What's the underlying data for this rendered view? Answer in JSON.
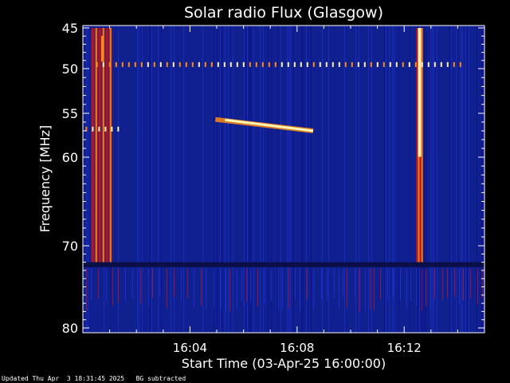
{
  "chart_data": {
    "type": "heatmap",
    "title": "Solar radio Flux (Glasgow)",
    "xlabel": "Start Time (03-Apr-25 16:00:00)",
    "ylabel": "Frequency [MHz]",
    "x_unit": "minutes after 16:00:00",
    "xlim": [
      0,
      15
    ],
    "ylim": [
      45,
      80
    ],
    "x_ticks": [
      {
        "value": 4,
        "label": "16:04"
      },
      {
        "value": 8,
        "label": "16:08"
      },
      {
        "value": 12,
        "label": "16:12"
      }
    ],
    "y_ticks": [
      {
        "value": 45,
        "label": "45"
      },
      {
        "value": 50,
        "label": "50"
      },
      {
        "value": 55,
        "label": "55"
      },
      {
        "value": 60,
        "label": "60"
      },
      {
        "value": 70,
        "label": "70"
      },
      {
        "value": 80,
        "label": "80"
      }
    ],
    "y_scale": "log-like (reversed, low frequency at top)",
    "colormap": [
      "#0a0a8c",
      "#1f35e0",
      "#c01818",
      "#ff8a10",
      "#fff4b0"
    ],
    "background_color": "#10208f",
    "features": [
      {
        "name": "burst",
        "t_start": 0.3,
        "t_end": 1.1,
        "f_low": 45,
        "f_high": 72,
        "intensity": "high"
      },
      {
        "name": "burst",
        "t_start": 12.45,
        "t_end": 12.7,
        "f_low": 45,
        "f_high": 72,
        "intensity": "very high"
      },
      {
        "name": "drifting emission",
        "t_start": 4.95,
        "t_end": 8.6,
        "f_start": 55.7,
        "f_end": 57.0,
        "intensity": "very high"
      },
      {
        "name": "narrowband interference",
        "freq": 49.5,
        "t_start": 0.5,
        "t_end": 14.1
      },
      {
        "name": "narrowband interference",
        "freq": 56.8,
        "t_start": 0.1,
        "t_end": 1.5
      },
      {
        "name": "data gap",
        "f_low": 72.0,
        "f_high": 72.6
      }
    ]
  },
  "footer": "Updated Thu Apr  3 18:31:45 2025   BG subtracted"
}
